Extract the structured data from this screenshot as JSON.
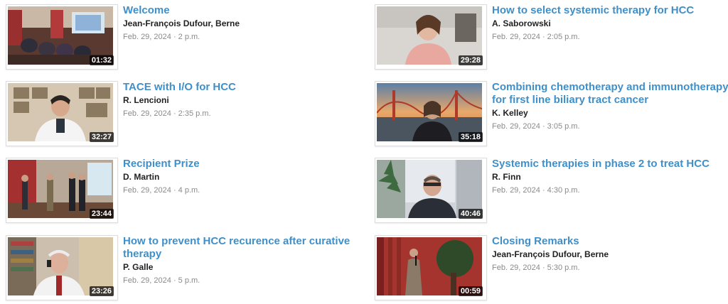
{
  "videos": [
    {
      "title": "Welcome",
      "speaker": "Jean-François Dufour, Berne",
      "date": "Feb. 29, 2024 · 2 p.m.",
      "duration": "01:32",
      "thumb_desc": "conference-room-audience"
    },
    {
      "title": "How to select systemic therapy for HCC",
      "speaker": "A. Saborowski",
      "date": "Feb. 29, 2024 · 2:05 p.m.",
      "duration": "29:28",
      "thumb_desc": "woman-webcam"
    },
    {
      "title": "TACE with I/O for HCC",
      "speaker": "R. Lencioni",
      "date": "Feb. 29, 2024 · 2:35 p.m.",
      "duration": "32:27",
      "thumb_desc": "man-white-coat-office"
    },
    {
      "title": "Combining chemotherapy and immunotherapy for first line biliary tract cancer",
      "speaker": "K. Kelley",
      "date": "Feb. 29, 2024 · 3:05 p.m.",
      "duration": "35:18",
      "thumb_desc": "golden-gate-background"
    },
    {
      "title": "Recipient Prize",
      "speaker": "D. Martin",
      "date": "Feb. 29, 2024 · 4 p.m.",
      "duration": "23:44",
      "thumb_desc": "award-ceremony"
    },
    {
      "title": "Systemic therapies in phase 2 to treat HCC",
      "speaker": "R. Finn",
      "date": "Feb. 29, 2024 · 4:30 p.m.",
      "duration": "40:46",
      "thumb_desc": "man-office-plants"
    },
    {
      "title": "How to prevent HCC recurence after curative therapy",
      "speaker": "P. Galle",
      "date": "Feb. 29, 2024 · 5 p.m.",
      "duration": "23:26",
      "thumb_desc": "man-headset-bookshelf"
    },
    {
      "title": "Closing Remarks",
      "speaker": "Jean-François Dufour, Berne",
      "date": "Feb. 29, 2024 · 5:30 p.m.",
      "duration": "00:59",
      "thumb_desc": "speaker-on-stage"
    }
  ],
  "colors": {
    "title": "#3f8fc9",
    "speaker": "#222222",
    "date": "#8a8a8a"
  }
}
